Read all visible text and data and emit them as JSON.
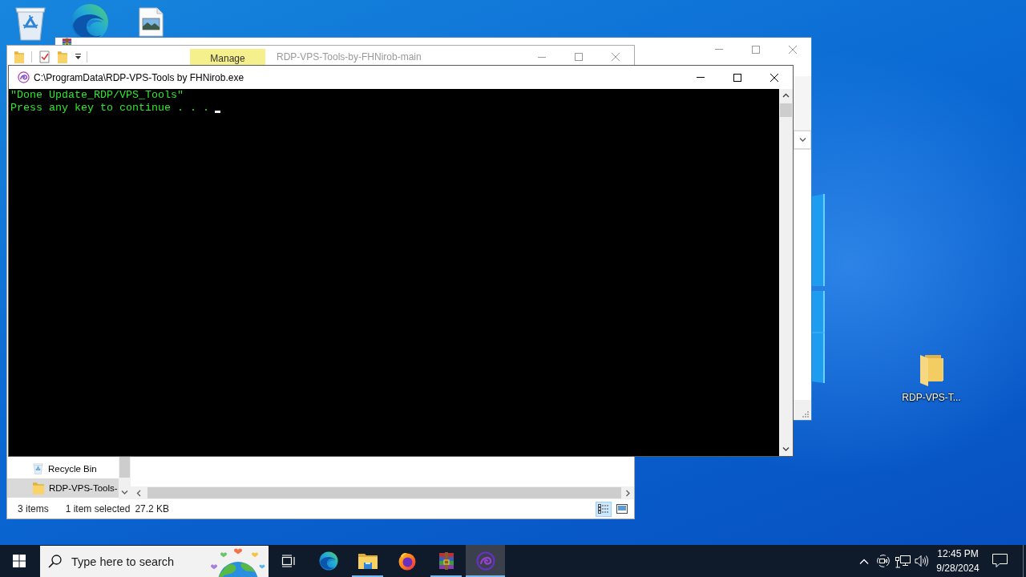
{
  "desktop": {
    "items": [
      {
        "kind": "folder",
        "label": "RDP-VPS-T..."
      }
    ]
  },
  "back_window": {
    "active": false
  },
  "explorer": {
    "active": false,
    "title": "RDP-VPS-Tools-by-FHNirob-main",
    "ribbon_tabs": [
      {
        "label": "Manage",
        "highlighted": true
      }
    ],
    "nav_items": [
      {
        "kind": "recycle_bin",
        "label": "Recycle Bin",
        "selected": false
      },
      {
        "kind": "folder",
        "label": "RDP-VPS-Tools-",
        "selected": true
      }
    ],
    "status": {
      "item_count": "3 items",
      "selection": "1 item selected",
      "size": "27.2 KB"
    },
    "views": [
      {
        "kind": "details",
        "selected": true
      },
      {
        "kind": "large_icons",
        "selected": false
      }
    ]
  },
  "console": {
    "active": true,
    "title": "C:\\ProgramData\\RDP-VPS-Tools by FHNirob.exe",
    "lines": [
      "\"Done Update_RDP/VPS_Tools\"",
      "Press any key to continue . . ."
    ]
  },
  "taskbar": {
    "search": {
      "placeholder": "Type here to search"
    },
    "apps": [
      {
        "kind": "edge",
        "running": false,
        "active": false
      },
      {
        "kind": "explorer",
        "running": true,
        "active": false
      },
      {
        "kind": "firefox",
        "running": false,
        "active": false
      },
      {
        "kind": "winrar",
        "running": true,
        "active": false
      },
      {
        "kind": "swirl",
        "running": true,
        "active": true
      }
    ],
    "clock": {
      "time": "12:45 PM",
      "date": "9/28/2024"
    }
  }
}
